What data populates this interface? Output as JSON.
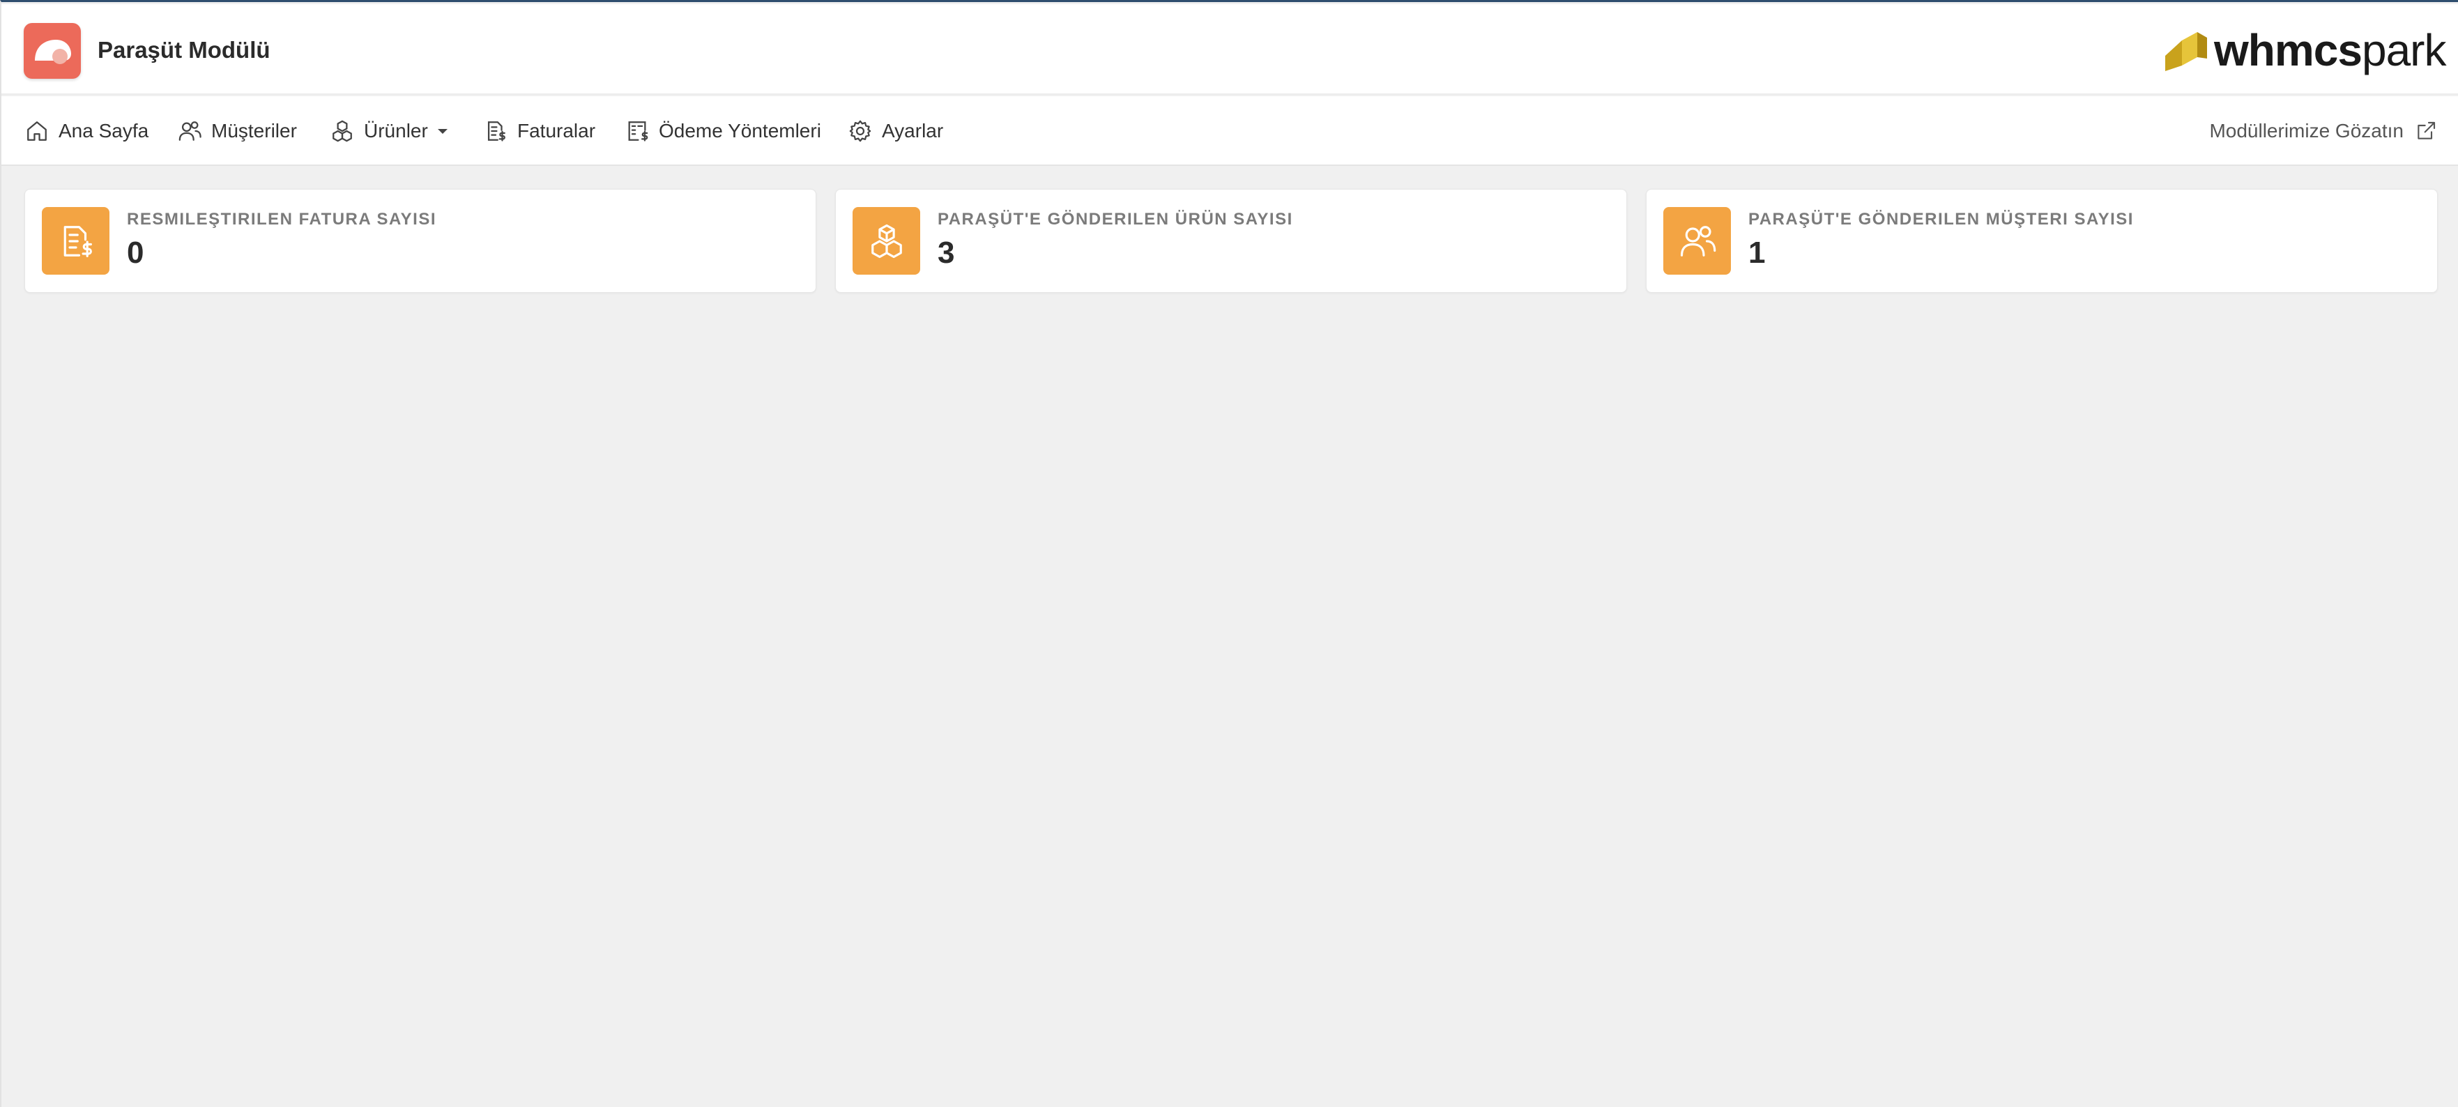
{
  "header": {
    "app_title": "Paraşüt Modülü",
    "brand_bold": "whmcs",
    "brand_light": "park"
  },
  "nav": {
    "items": [
      {
        "label": "Ana Sayfa",
        "icon": "home-icon"
      },
      {
        "label": "Müşteriler",
        "icon": "users-icon"
      },
      {
        "label": "Ürünler",
        "icon": "boxes-icon",
        "has_dropdown": true
      },
      {
        "label": "Faturalar",
        "icon": "invoice-icon"
      },
      {
        "label": "Ödeme Yöntemleri",
        "icon": "payment-methods-icon"
      },
      {
        "label": "Ayarlar",
        "icon": "gear-icon"
      }
    ],
    "external_link": {
      "label": "Modüllerimize Gözatın",
      "icon": "external-link-icon"
    }
  },
  "stats": [
    {
      "label": "RESMILEŞTIRILEN FATURA SAYISI",
      "value": "0",
      "icon": "invoice-dollar-icon"
    },
    {
      "label": "PARAŞÜT'E GÖNDERILEN ÜRÜN SAYISI",
      "value": "3",
      "icon": "boxes-icon"
    },
    {
      "label": "PARAŞÜT'E GÖNDERILEN MÜŞTERI SAYISI",
      "value": "1",
      "icon": "users-icon"
    }
  ],
  "colors": {
    "accent": "#f3a443",
    "app_logo": "#ec6a5a",
    "brand_mark": "#d9b526",
    "background": "#f0f0f0"
  }
}
